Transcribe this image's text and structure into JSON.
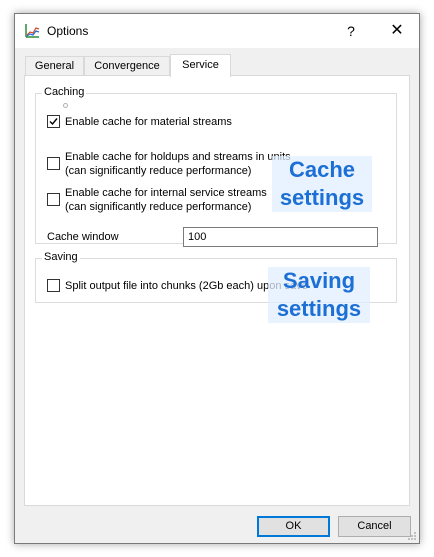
{
  "window": {
    "title": "Options",
    "help_glyph": "?",
    "close_glyph": "✕"
  },
  "tabs": [
    {
      "label": "General",
      "active": false
    },
    {
      "label": "Convergence",
      "active": false
    },
    {
      "label": "Service",
      "active": true
    }
  ],
  "caching": {
    "group_label": "Caching",
    "options": [
      {
        "label": "Enable cache for material streams",
        "checked": true
      },
      {
        "label": "Enable cache for holdups and streams in units",
        "sublabel": "(can significantly reduce performance)",
        "checked": false
      },
      {
        "label": "Enable cache for internal service streams",
        "sublabel": "(can significantly reduce performance)",
        "checked": false
      }
    ],
    "cache_window_label": "Cache window",
    "cache_window_value": "100"
  },
  "saving": {
    "group_label": "Saving",
    "split_label": "Split output file into chunks (2Gb each) upon save",
    "split_checked": false
  },
  "annotations": {
    "cache_line1": "Cache",
    "cache_line2": "settings",
    "saving_line1": "Saving",
    "saving_line2": "settings",
    "color": "#1c6fd4"
  },
  "buttons": {
    "ok": "OK",
    "cancel": "Cancel"
  }
}
